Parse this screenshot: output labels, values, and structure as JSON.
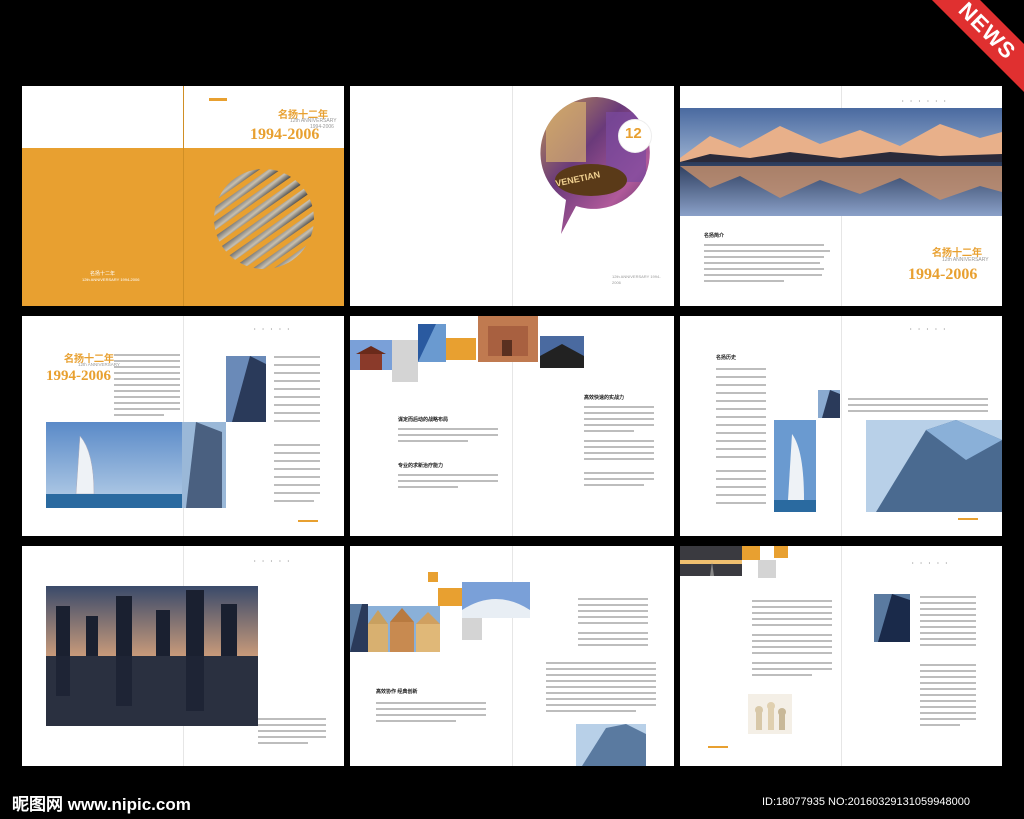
{
  "ribbon": {
    "text": "NEWS"
  },
  "brand": {
    "title_cn": "名扬十二年",
    "anniversary": "12th ANNIVERSARY",
    "years_small": "1994-2006",
    "years_big": "1994-2006"
  },
  "badge": {
    "number": "12"
  },
  "venetian_sign": "VENETIAN",
  "cover_small": {
    "title_cn": "名扬十二年",
    "line": "12th ANNIVERSARY 1994-2006"
  },
  "page3": {
    "footer": "12th ANNIVERSARY 1994-2006"
  },
  "headings": {
    "intro": "名扬简介",
    "strategy": "谋定而后动的战略布局",
    "management": "专业的求新治疗能力",
    "execution": "高效快速的实战力",
    "history": "名扬历史",
    "innovation": "高效协作 经典创新"
  },
  "footer": {
    "site": "昵图网 www.nipic.com",
    "id": "ID:18077935 NO:20160329131059948000"
  },
  "colors": {
    "accent": "#e8a030",
    "background": "#000000",
    "ribbon": "#e03030"
  }
}
